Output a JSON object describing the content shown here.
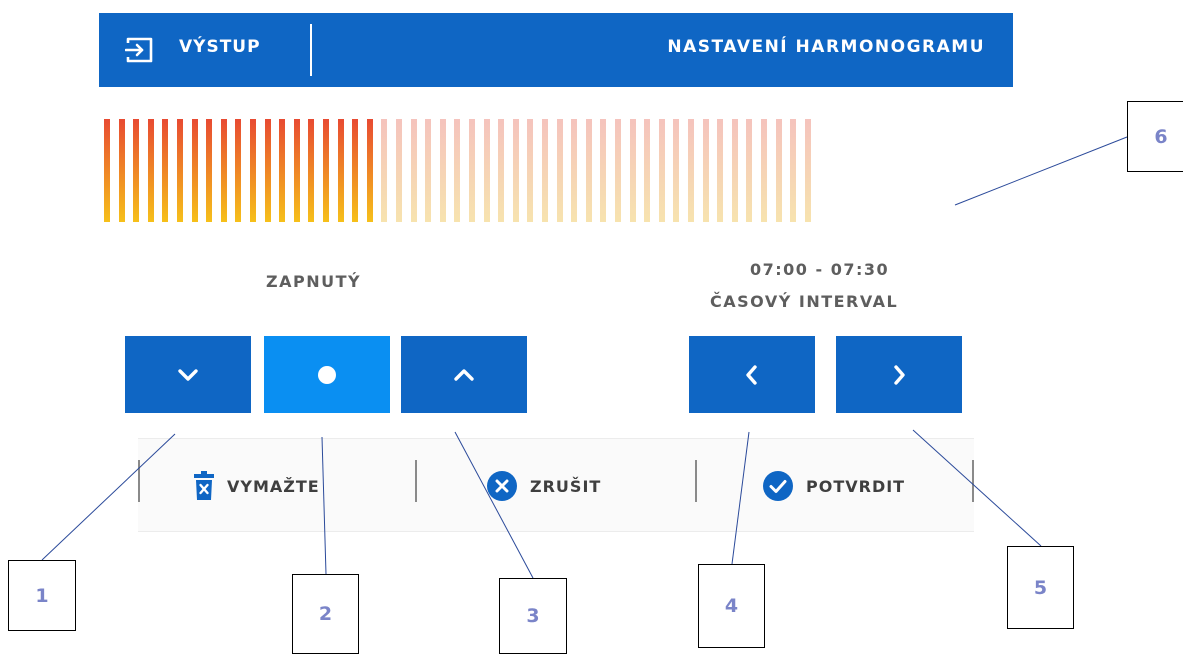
{
  "header": {
    "exit_label": "VÝSTUP",
    "title": "NASTAVENÍ HARMONOGRAMU",
    "background_color": "#0f66c4",
    "exit_icon": "exit-icon"
  },
  "schedule": {
    "slots_active": [
      1,
      1,
      1,
      1,
      1,
      1,
      1,
      1,
      1,
      1,
      1,
      1,
      1,
      1,
      1,
      1,
      1,
      1,
      1,
      0,
      0,
      0,
      0,
      0,
      0,
      0,
      0,
      0,
      0,
      0,
      0,
      0,
      0,
      0,
      0,
      0,
      0,
      0,
      0,
      0,
      0,
      0,
      0,
      0,
      0,
      0,
      0,
      0,
      0
    ],
    "active_gradient": [
      "#e84a32",
      "#f6c01a"
    ],
    "inactive_gradient": [
      "#f5c3bd",
      "#f7e3ae"
    ]
  },
  "mode": {
    "label": "ZAPNUTÝ"
  },
  "time": {
    "range": "07:00 - 07:30",
    "interval_label": "ČASOVÝ INTERVAL"
  },
  "buttons": {
    "down_icon": "chevron-down-icon",
    "toggle_icon": "dot-icon",
    "up_icon": "chevron-up-icon",
    "prev_icon": "chevron-left-icon",
    "next_icon": "chevron-right-icon",
    "primary_color": "#0f66c4",
    "selected_color": "#0a8ff2"
  },
  "actions": {
    "delete_label": "VYMAŽTE",
    "cancel_label": "ZRUŠIT",
    "confirm_label": "POTVRDIT",
    "delete_icon": "trash-icon",
    "cancel_icon": "close-circle-icon",
    "confirm_icon": "check-circle-icon"
  },
  "callouts": [
    "1",
    "2",
    "3",
    "4",
    "5",
    "6"
  ]
}
